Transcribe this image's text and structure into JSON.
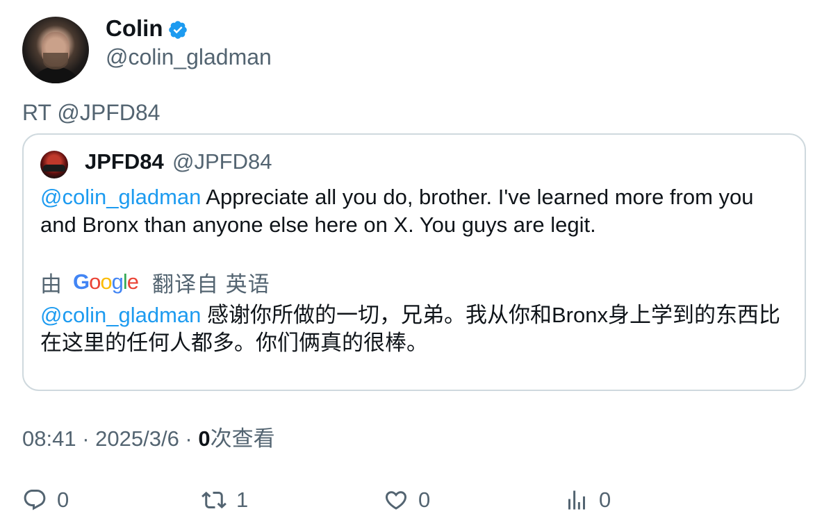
{
  "author": {
    "name": "Colin",
    "handle": "@colin_gladman",
    "verified_color": "#1d9bf0"
  },
  "retweet_label": "RT @JPFD84",
  "quoted": {
    "name": "JPFD84",
    "handle": "@JPFD84",
    "mention": "@colin_gladman",
    "text": " Appreciate all you do, brother. I've learned more from you and Bronx than anyone else here on X. You guys are legit."
  },
  "translation": {
    "by_label": "由",
    "provider": "Google",
    "from_label": "翻译自 英语",
    "mention": "@colin_gladman",
    "text": " 感谢你所做的一切，兄弟。我从你和Bronx身上学到的东西比在这里的任何人都多。你们俩真的很棒。"
  },
  "meta": {
    "time": "08:41",
    "sep1": " · ",
    "date": "2025/3/6",
    "sep2": " · ",
    "views_count": "0",
    "views_label": "次查看"
  },
  "actions": {
    "replies": "0",
    "retweets": "1",
    "likes": "0",
    "views": "0"
  },
  "icons": {
    "reply": "reply-icon",
    "retweet": "retweet-icon",
    "like": "heart-icon",
    "views": "analytics-icon",
    "verified": "verified-badge-icon"
  },
  "colors": {
    "link": "#1d9bf0",
    "secondary_text": "#536471",
    "border": "#cfd9de"
  }
}
